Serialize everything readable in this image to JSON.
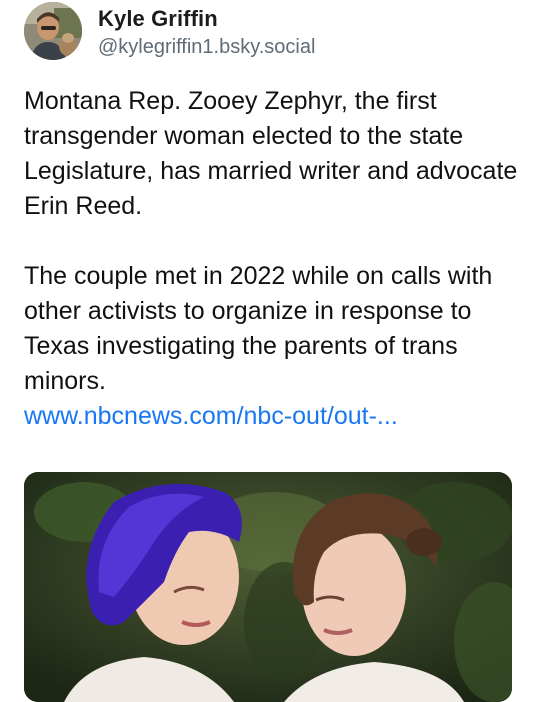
{
  "post": {
    "author_name": "Kyle Griffin",
    "author_handle": "@kylegriffin1.bsky.social",
    "paragraphs": [
      "Montana Rep. Zooey Zephyr, the first transgender woman elected to the state Legislature, has married writer and advocate Erin Reed.",
      "The couple met in 2022 while on calls with other activists to organize in response to Texas investigating the parents of trans minors."
    ],
    "link_text": "www.nbcnews.com/nbc-out/out-..."
  },
  "colors": {
    "name": "#1c1c1c",
    "handle": "#5f6b78",
    "body": "#111111",
    "link": "#1877f2"
  },
  "icons": {
    "avatar": "avatar-photo",
    "embed": "wedding-photo"
  }
}
